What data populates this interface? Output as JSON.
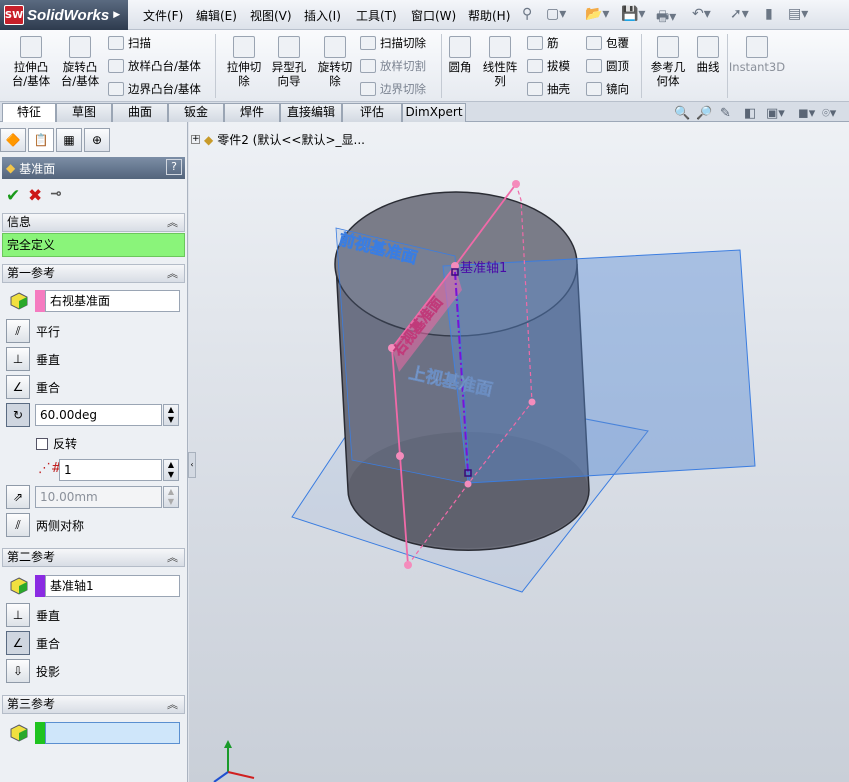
{
  "app": {
    "logo_text": "SolidWorks",
    "badge": "SW"
  },
  "menu": [
    "文件(F)",
    "编辑(E)",
    "视图(V)",
    "插入(I)",
    "工具(T)",
    "窗口(W)",
    "帮助(H)"
  ],
  "commands": {
    "extrude_boss": "拉伸凸\n台/基体",
    "revolve_boss": "旋转凸\n台/基体",
    "sweep": "扫描",
    "loft_boss": "放样凸台/基体",
    "boundary_boss": "边界凸台/基体",
    "extrude_cut": "拉伸切\n除",
    "hole_wizard": "异型孔\n向导",
    "revolve_cut": "旋转切\n除",
    "sweep_cut": "扫描切除",
    "loft_cut": "放样切割",
    "boundary_cut": "边界切除",
    "fillet": "圆角",
    "linear_pattern": "线性阵\n列",
    "rib": "筋",
    "draft": "拔模",
    "shell": "抽壳",
    "wrap": "包覆",
    "dome": "圆顶",
    "mirror": "镜向",
    "ref_geometry": "参考几\n何体",
    "curves": "曲线",
    "instant3d": "Instant3D"
  },
  "tabs": [
    "特征",
    "草图",
    "曲面",
    "钣金",
    "焊件",
    "直接编辑",
    "评估",
    "DimXpert"
  ],
  "tree": {
    "root": "零件2 (默认<<默认>_显..."
  },
  "pm": {
    "title": "基准面",
    "help": "?",
    "info_header": "信息",
    "status": "完全定义",
    "ref1": {
      "header": "第一参考",
      "selection": "右视基准面",
      "parallel": "平行",
      "perpendicular": "垂直",
      "coincident": "重合",
      "angle": "60.00deg",
      "flip": "反转",
      "count": "1",
      "distance": "10.00mm",
      "mid_plane": "两侧对称"
    },
    "ref2": {
      "header": "第二参考",
      "selection": "基准轴1",
      "perpendicular": "垂直",
      "coincident": "重合",
      "project": "投影"
    },
    "ref3": {
      "header": "第三参考",
      "selection": ""
    }
  },
  "viewport": {
    "front_plane": "前视基准面",
    "right_plane": "右视基准面",
    "top_plane": "上视基准面",
    "axis": "基准轴1"
  },
  "colors": {
    "status_bg": "#8af47a",
    "ref1_swatch": "#f57bc0",
    "ref2_swatch": "#8a2be2",
    "ref3_swatch": "#1fc31f",
    "plane_blue": "#3b7de0",
    "preview_pink": "#f06aa8"
  }
}
